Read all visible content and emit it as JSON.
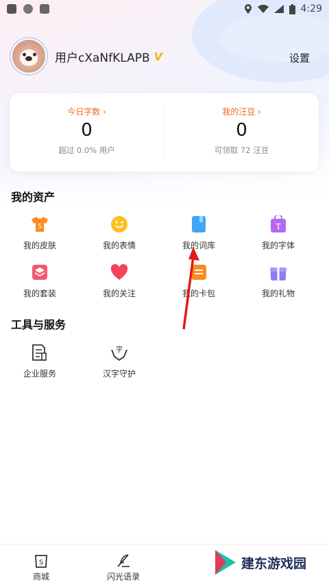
{
  "status_bar": {
    "time": "4:29"
  },
  "profile": {
    "username": "用户cXaNfKLAPB",
    "vip_badge": "V",
    "settings_label": "设置"
  },
  "stats": {
    "today_words": {
      "label": "今日字数 ›",
      "value": "0",
      "sub": "超过 0.0% 用户"
    },
    "beans": {
      "label": "我的汪豆 ›",
      "value": "0",
      "sub": "可领取 72 汪豆"
    }
  },
  "assets": {
    "title": "我的资产",
    "items": [
      {
        "label": "我的皮肤",
        "icon": "tshirt-icon",
        "color": "#ff8a1f"
      },
      {
        "label": "我的表情",
        "icon": "smiley-icon",
        "color": "#ffbf1f"
      },
      {
        "label": "我的词库",
        "icon": "book-icon",
        "color": "#3fa7f5"
      },
      {
        "label": "我的字体",
        "icon": "font-bag-icon",
        "color": "#b46af0"
      },
      {
        "label": "我的套装",
        "icon": "layers-icon",
        "color": "#f25a6e"
      },
      {
        "label": "我的关注",
        "icon": "heart-icon",
        "color": "#f2455c"
      },
      {
        "label": "我的卡包",
        "icon": "card-icon",
        "color": "#ff8a1f"
      },
      {
        "label": "我的礼物",
        "icon": "gift-icon",
        "color": "#8c7cf2"
      }
    ]
  },
  "tools": {
    "title": "工具与服务",
    "items": [
      {
        "label": "企业服务",
        "icon": "document-icon"
      },
      {
        "label": "汉字守护",
        "icon": "hands-character-icon"
      }
    ]
  },
  "bottom_nav": {
    "tabs": [
      {
        "label": "商城",
        "icon": "shop-icon"
      },
      {
        "label": "闪光语录",
        "icon": "quill-icon"
      }
    ]
  },
  "watermark": {
    "text": "建东游戏园"
  }
}
